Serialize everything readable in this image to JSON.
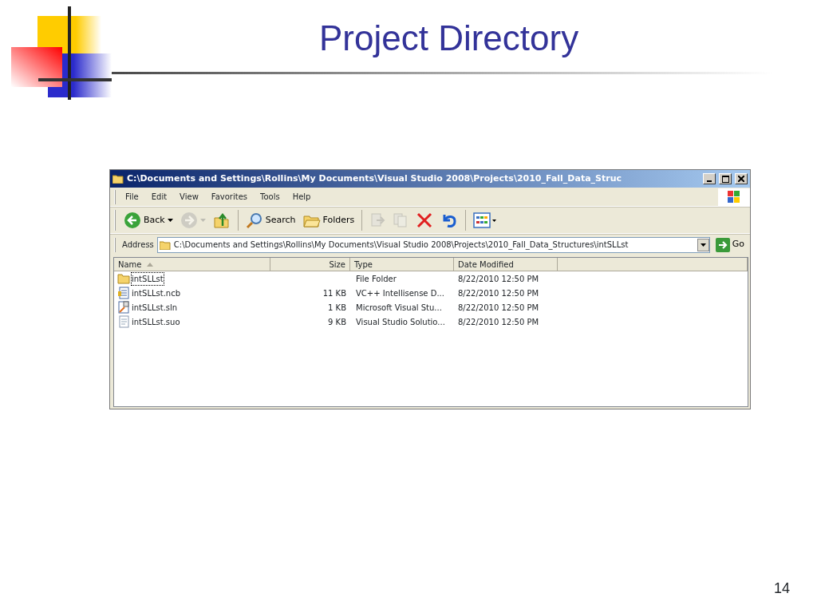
{
  "slide": {
    "title": "Project Directory",
    "page_number": "14"
  },
  "window": {
    "title": "C:\\Documents and Settings\\Rollins\\My Documents\\Visual Studio 2008\\Projects\\2010_Fall_Data_Struc",
    "menu": [
      "File",
      "Edit",
      "View",
      "Favorites",
      "Tools",
      "Help"
    ],
    "toolbar": [
      {
        "kind": "back",
        "label": "Back",
        "disabled": false
      },
      {
        "kind": "forward",
        "disabled": true
      },
      {
        "kind": "up",
        "disabled": false
      },
      {
        "kind": "search",
        "label": "Search",
        "disabled": false
      },
      {
        "kind": "folders",
        "label": "Folders",
        "disabled": false
      },
      {
        "kind": "move",
        "disabled": true
      },
      {
        "kind": "copy",
        "disabled": true
      },
      {
        "kind": "delete",
        "disabled": false
      },
      {
        "kind": "undo",
        "disabled": false
      },
      {
        "kind": "views",
        "disabled": false
      }
    ],
    "address": {
      "label": "Address",
      "value": "C:\\Documents and Settings\\Rollins\\My Documents\\Visual Studio 2008\\Projects\\2010_Fall_Data_Structures\\intSLLst",
      "go_label": "Go"
    },
    "columns": [
      {
        "label": "Name",
        "sorted": true
      },
      {
        "label": "Size",
        "sorted": false
      },
      {
        "label": "Type",
        "sorted": false
      },
      {
        "label": "Date Modified",
        "sorted": false
      }
    ],
    "rows": [
      {
        "kind": "folder",
        "name": "intSLLst",
        "size": "",
        "type": "File Folder",
        "date": "8/22/2010 12:50 PM",
        "focused": true
      },
      {
        "kind": "ncb",
        "name": "intSLLst.ncb",
        "size": "11 KB",
        "type": "VC++ Intellisense D...",
        "date": "8/22/2010 12:50 PM",
        "focused": false
      },
      {
        "kind": "sln",
        "name": "intSLLst.sln",
        "size": "1 KB",
        "type": "Microsoft Visual Stu...",
        "date": "8/22/2010 12:50 PM",
        "focused": false
      },
      {
        "kind": "suo",
        "name": "intSLLst.suo",
        "size": "9 KB",
        "type": "Visual Studio Solutio...",
        "date": "8/22/2010 12:50 PM",
        "focused": false
      }
    ]
  }
}
